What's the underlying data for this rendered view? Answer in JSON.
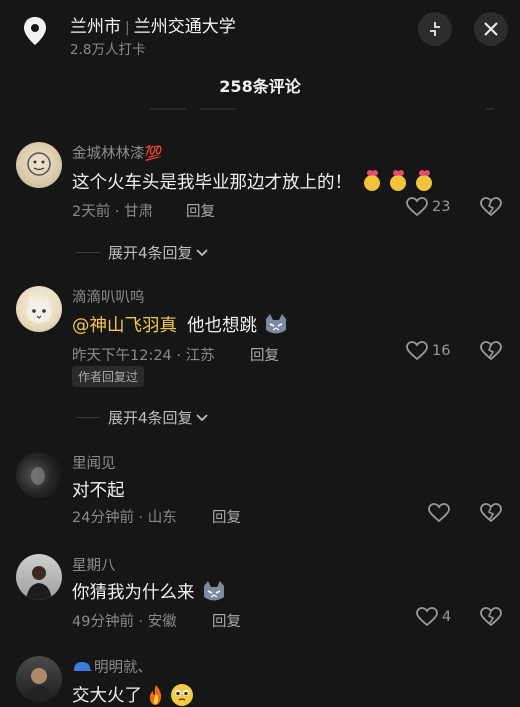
{
  "header": {
    "city": "兰州市",
    "place": "兰州交通大学",
    "checkins": "2.8万人打卡",
    "comment_count": "258条评论"
  },
  "comments": [
    {
      "user": "金城林林漆💯",
      "text": "这个火车头是我毕业那边才放上的！",
      "time_loc": "2天前 · 甘肃",
      "reply": "回复",
      "likes": "23",
      "expand": "展开4条回复"
    },
    {
      "user": "滴滴叭叭呜",
      "mention": "@神山飞羽真",
      "text": "他也想跳",
      "time_loc": "昨天下午12:24 · 江苏",
      "reply": "回复",
      "likes": "16",
      "badge": "作者回复过",
      "expand": "展开4条回复"
    },
    {
      "user": "里闻见",
      "text": "对不起",
      "time_loc": "24分钟前 · 山东",
      "reply": "回复",
      "likes": ""
    },
    {
      "user": "星期八",
      "text": "你猜我为什么来",
      "time_loc": "49分钟前 · 安徽",
      "reply": "回复",
      "likes": "4"
    },
    {
      "user": "明明就、",
      "text": "交大火了",
      "time_loc": "",
      "reply": "",
      "likes": ""
    }
  ],
  "icons": {
    "location": "location-pin-icon",
    "minimize": "minimize-icon",
    "close": "close-icon",
    "like": "heart-outline-icon",
    "dislike": "broken-heart-icon",
    "expand": "chevron-down-icon"
  }
}
